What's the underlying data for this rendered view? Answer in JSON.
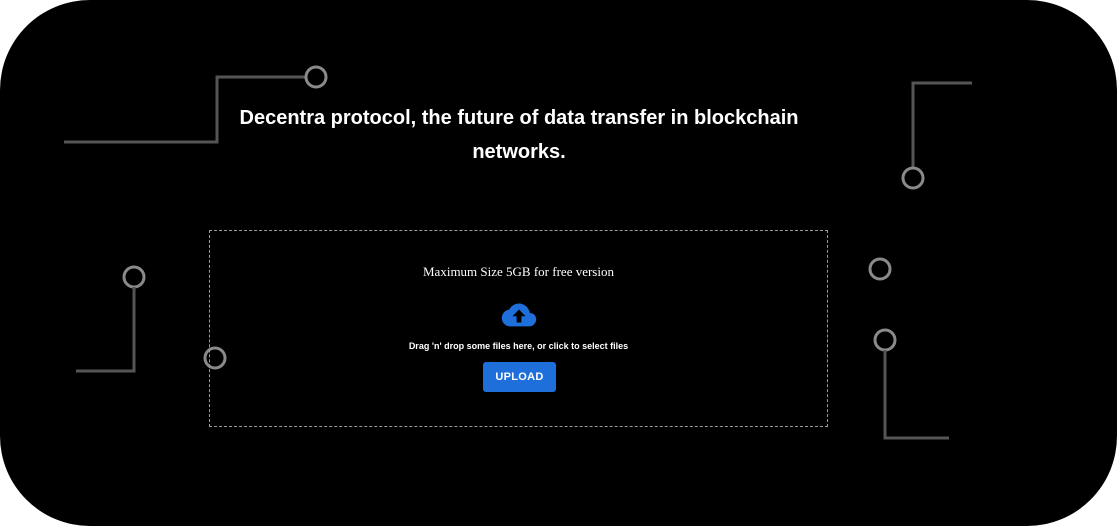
{
  "theme": {
    "background": "#000000",
    "text": "#ffffff",
    "accent": "#1e6fd9",
    "circuit_line": "#555555",
    "dropzone_border": "#9a9a9a"
  },
  "hero": {
    "headline": "Decentra protocol, the future of data transfer in blockchain networks."
  },
  "dropzone": {
    "max_size_text": "Maximum Size 5GB for free version",
    "icon": "cloud-upload-icon",
    "instruction": "Drag 'n' drop some files here, or click to select files",
    "upload_label": "UPLOAD"
  },
  "decorations": {
    "icon": "circuit-trace-icon"
  }
}
